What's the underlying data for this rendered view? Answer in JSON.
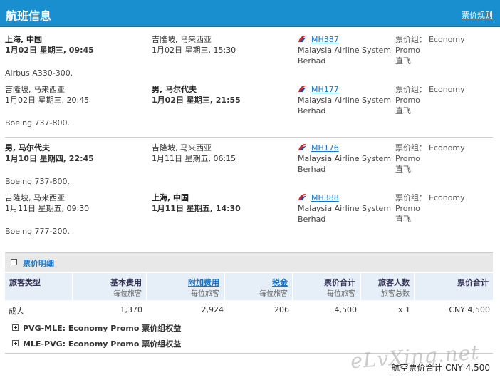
{
  "header": {
    "title": "航班信息",
    "rules_link": "票价规则"
  },
  "fare_group_label": "票价组：",
  "segments": [
    {
      "dep_place": "上海, 中国",
      "dep_time": "1月02日 星期三, 09:45",
      "dep_bold": true,
      "arr_place": "吉隆坡, 马来西亚",
      "arr_time": "1月02日 星期三, 15:30",
      "arr_bold": false,
      "flight": "MH387",
      "airline": [
        "Malaysia Airline System",
        "Berhad"
      ],
      "fare_group": "Economy",
      "fare_sub": "Promo",
      "direct": "直飞",
      "aircraft": "Airbus A330-300."
    },
    {
      "dep_place": "吉隆坡, 马来西亚",
      "dep_time": "1月02日 星期三, 20:45",
      "dep_bold": false,
      "arr_place": "男, 马尔代夫",
      "arr_time": "1月02日 星期三, 21:55",
      "arr_bold": true,
      "flight": "MH177",
      "airline": [
        "Malaysia Airline System",
        "Berhad"
      ],
      "fare_group": "Economy",
      "fare_sub": "Promo",
      "direct": "直飞",
      "aircraft": "Boeing 737-800."
    },
    {
      "dep_place": "男, 马尔代夫",
      "dep_time": "1月10日 星期四, 22:45",
      "dep_bold": true,
      "arr_place": "吉隆坡, 马来西亚",
      "arr_time": "1月11日 星期五, 06:15",
      "arr_bold": false,
      "flight": "MH176",
      "airline": [
        "Malaysia Airline System",
        "Berhad"
      ],
      "fare_group": "Economy",
      "fare_sub": "Promo",
      "direct": "直飞",
      "aircraft": "Boeing 737-800."
    },
    {
      "dep_place": "吉隆坡, 马来西亚",
      "dep_time": "1月11日 星期五, 09:30",
      "dep_bold": false,
      "arr_place": "上海, 中国",
      "arr_time": "1月11日 星期五, 14:30",
      "arr_bold": true,
      "flight": "MH388",
      "airline": [
        "Malaysia Airline System",
        "Berhad"
      ],
      "fare_group": "Economy",
      "fare_sub": "Promo",
      "direct": "直飞",
      "aircraft": "Boeing 777-200."
    }
  ],
  "fare_detail": {
    "title": "票价明细",
    "columns": [
      {
        "a": "旅客类型",
        "b": ""
      },
      {
        "a": "基本费用",
        "b": "每位旅客"
      },
      {
        "a": "附加费用",
        "b": "每位旅客"
      },
      {
        "a": "税金",
        "b": "每位旅客"
      },
      {
        "a": "票价合计",
        "b": "每位旅客"
      },
      {
        "a": "旅客人数",
        "b": "旅客总数"
      },
      {
        "a": "票价合计",
        "b": ""
      }
    ],
    "row": [
      "成人",
      "1,370",
      "2,924",
      "206",
      "4,500",
      "x 1",
      "CNY 4,500"
    ]
  },
  "rules": [
    "PVG-MLE: Economy Promo 票价组权益",
    "MLE-PVG: Economy Promo 票价组权益"
  ],
  "total": "航空票价合计  CNY 4,500",
  "watermark": "eLvXing.net",
  "colors": {
    "header": "#1a8fd0",
    "link": "#1a75c8"
  }
}
